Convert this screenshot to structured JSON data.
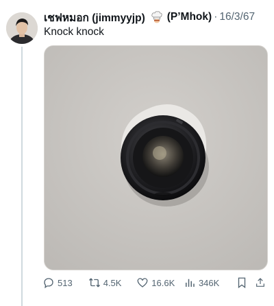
{
  "tweet": {
    "author_name": "เชฟหมอก (jimmyyjp)",
    "author_alias": "(P’Mhok)",
    "separator": "·",
    "date": "16/3/67",
    "text": "Knock knock",
    "media_icon": "door-peephole-photo",
    "chef_badge_icon": "chef-hat-emoji"
  },
  "actions": {
    "replies": "513",
    "reposts": "4.5K",
    "likes": "16.6K",
    "views": "346K"
  },
  "colors": {
    "text": "#0f1419",
    "secondary": "#536471",
    "thread_line": "#cfd9de",
    "wall": "#c9c6c2"
  }
}
